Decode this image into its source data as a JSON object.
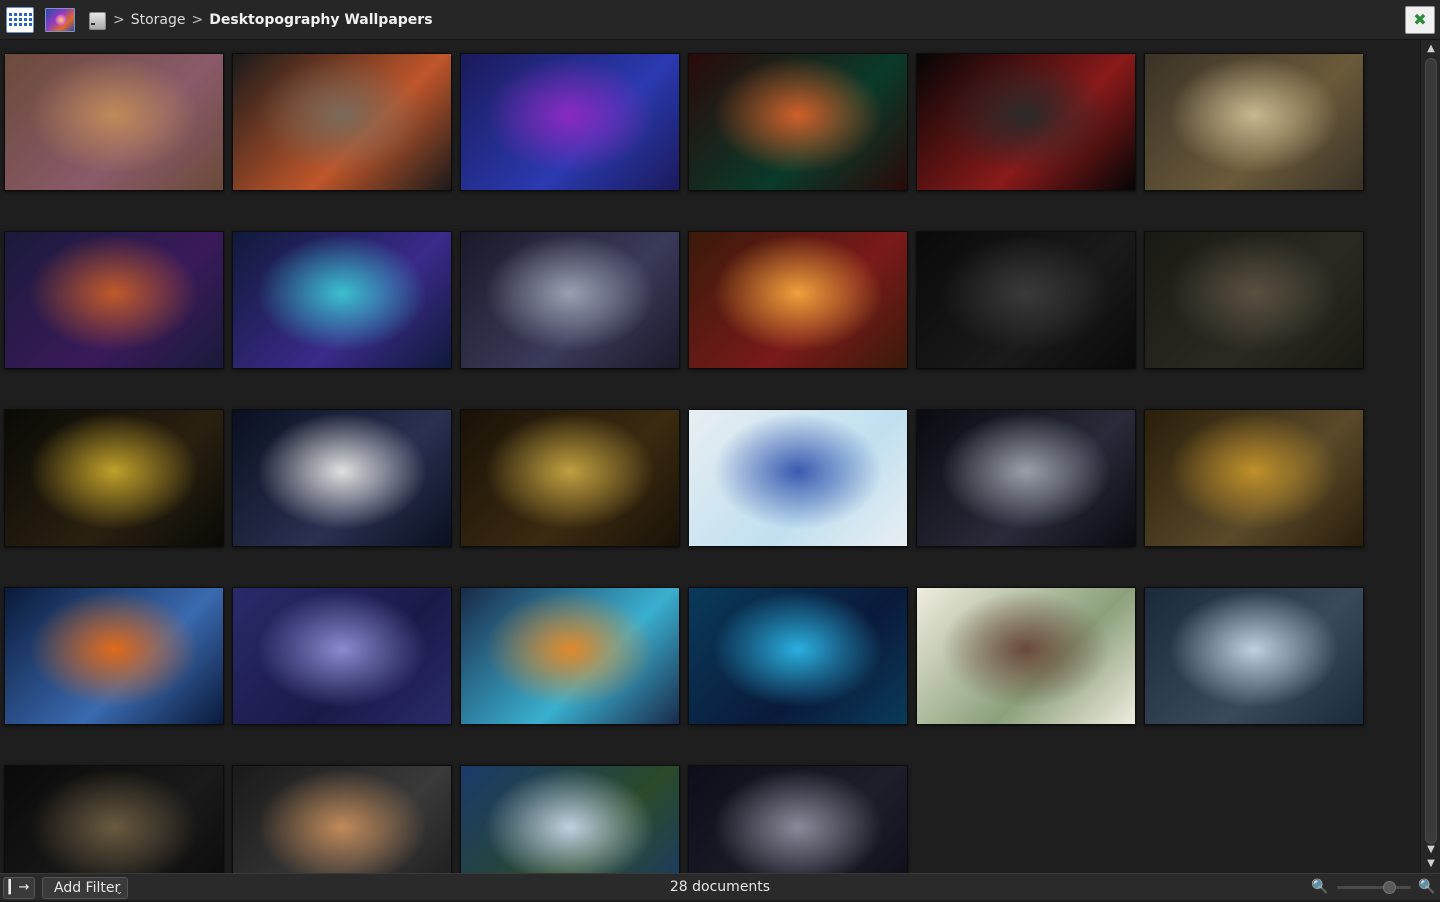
{
  "header": {
    "breadcrumb": [
      {
        "label": "Storage"
      },
      {
        "label": "Desktopography Wallpapers"
      }
    ],
    "separator": ">"
  },
  "icons": {
    "view_mode": "grid-view-icon",
    "app": "app-preview-icon",
    "drive": "storage-drive-icon",
    "fullscreen": "exit-fullscreen-icon",
    "sidebar_toggle": "sidebar-toggle-icon",
    "zoom_out": "zoom-out-icon",
    "zoom_in": "zoom-in-icon"
  },
  "gallery": {
    "columns": 6,
    "items": [
      {
        "colors": [
          "#6b4a3a",
          "#c08a5a",
          "#8a5a6a"
        ]
      },
      {
        "colors": [
          "#1a1a1a",
          "#7a6a5a",
          "#c0562a"
        ]
      },
      {
        "colors": [
          "#1a1a5a",
          "#8a2ac0",
          "#2a3ab0"
        ]
      },
      {
        "colors": [
          "#2a0a0a",
          "#d0602a",
          "#0a3a2a"
        ]
      },
      {
        "colors": [
          "#050505",
          "#2a2a2a",
          "#8a1a1a"
        ]
      },
      {
        "colors": [
          "#3a3226",
          "#c8b890",
          "#6a5a3a"
        ]
      },
      {
        "colors": [
          "#1a1a3a",
          "#c05a2a",
          "#3a1a5a"
        ]
      },
      {
        "colors": [
          "#101a3a",
          "#3ac0d0",
          "#3a2a8a"
        ]
      },
      {
        "colors": [
          "#1a1a2a",
          "#9aa0b0",
          "#3a3a5a"
        ]
      },
      {
        "colors": [
          "#3a1a0a",
          "#f0a03a",
          "#7a1a1a"
        ]
      },
      {
        "colors": [
          "#0a0a0a",
          "#3a3a3a",
          "#1a1a1a"
        ]
      },
      {
        "colors": [
          "#1a1a14",
          "#5a5040",
          "#2a2a22"
        ]
      },
      {
        "colors": [
          "#0a0a06",
          "#c0a02a",
          "#2a2010"
        ]
      },
      {
        "colors": [
          "#0a1020",
          "#e0e0e0",
          "#2a3050"
        ]
      },
      {
        "colors": [
          "#1a1208",
          "#c0a040",
          "#3a2a10"
        ]
      },
      {
        "colors": [
          "#e8eef2",
          "#3a5ab0",
          "#c0e0f0"
        ]
      },
      {
        "colors": [
          "#0a0a10",
          "#9aa0aa",
          "#2a2a3a"
        ]
      },
      {
        "colors": [
          "#2a1e0a",
          "#c0902a",
          "#5a4a2a"
        ]
      },
      {
        "colors": [
          "#0a1a3a",
          "#e06a1a",
          "#3a6ab0"
        ]
      },
      {
        "colors": [
          "#2a2a6a",
          "#8a8ad0",
          "#1a1a4a"
        ]
      },
      {
        "colors": [
          "#1a2a4a",
          "#e08a2a",
          "#3ab0d0"
        ]
      },
      {
        "colors": [
          "#0a3a5a",
          "#2ab0e0",
          "#0a1a3a"
        ]
      },
      {
        "colors": [
          "#f0ece0",
          "#6a4a3a",
          "#8aa07a"
        ]
      },
      {
        "colors": [
          "#1a2a3a",
          "#c0d0e0",
          "#3a4a5a"
        ]
      },
      {
        "colors": [
          "#0a0a0a",
          "#6a5a40",
          "#1a1a1a"
        ]
      },
      {
        "colors": [
          "#1a1a1a",
          "#c08a5a",
          "#3a3a3a"
        ]
      },
      {
        "colors": [
          "#1a3a6a",
          "#c0d0e0",
          "#2a4a2a"
        ]
      },
      {
        "colors": [
          "#0e0e1a",
          "#8a8a9a",
          "#1e1e2a"
        ]
      }
    ]
  },
  "footer": {
    "add_filter_label": "Add Filter",
    "document_count": "28 documents",
    "zoom_level": 0.7
  }
}
